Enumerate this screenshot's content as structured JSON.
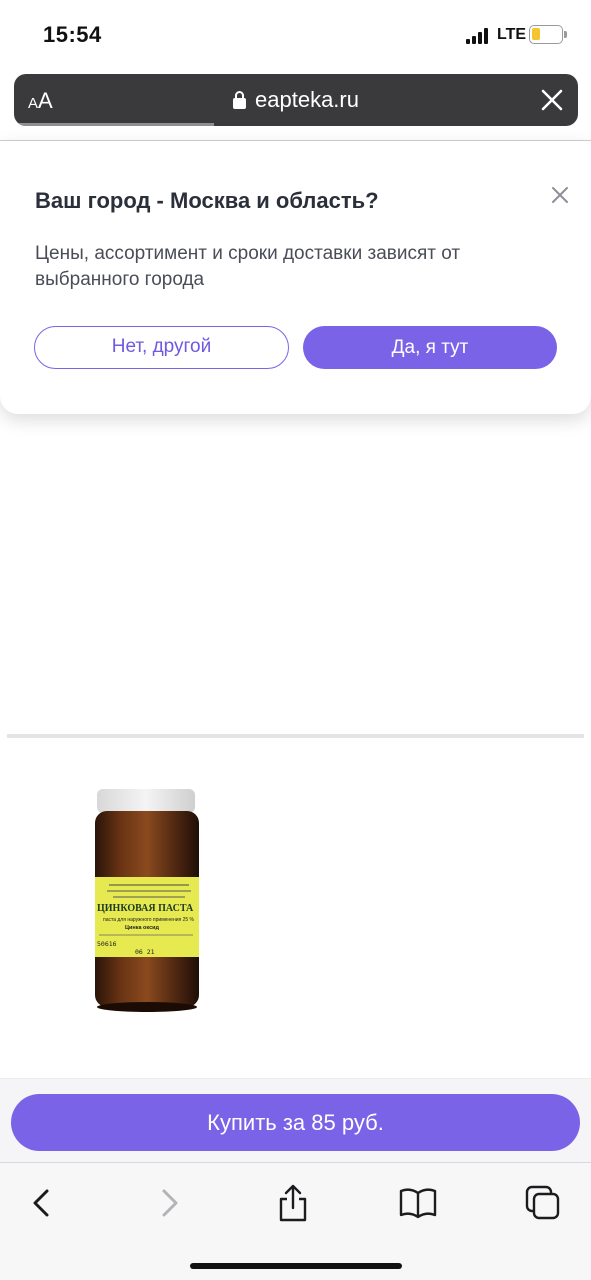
{
  "status_bar": {
    "time": "15:54",
    "network": "LTE",
    "battery_color": "#f4c431"
  },
  "address_bar": {
    "text_size_label_small": "A",
    "text_size_label_large": "A",
    "url": "eapteka.ru",
    "lock_icon": "lock-icon",
    "close_icon": "close-icon"
  },
  "city_popup": {
    "title": "Ваш город - Москва и область?",
    "text": "Цены, ассортимент и сроки доставки зависят от выбранного города",
    "decline_label": "Нет, другой",
    "confirm_label": "Да, я тут",
    "accent_color": "#7b63e8"
  },
  "product": {
    "image_icon": "zinc-paste-jar-image",
    "label_title": "ЦИНКОВАЯ ПАСТА",
    "label_subtitle": "паста для наружного применения 25 %",
    "label_ingredient": "Цинка оксид",
    "lot": "50616",
    "expiry": "06 21"
  },
  "buy_bar": {
    "label": "Купить за 85 руб."
  },
  "toolbar": {
    "items": [
      "back-icon",
      "forward-icon",
      "share-icon",
      "bookmarks-icon",
      "tabs-icon"
    ]
  }
}
